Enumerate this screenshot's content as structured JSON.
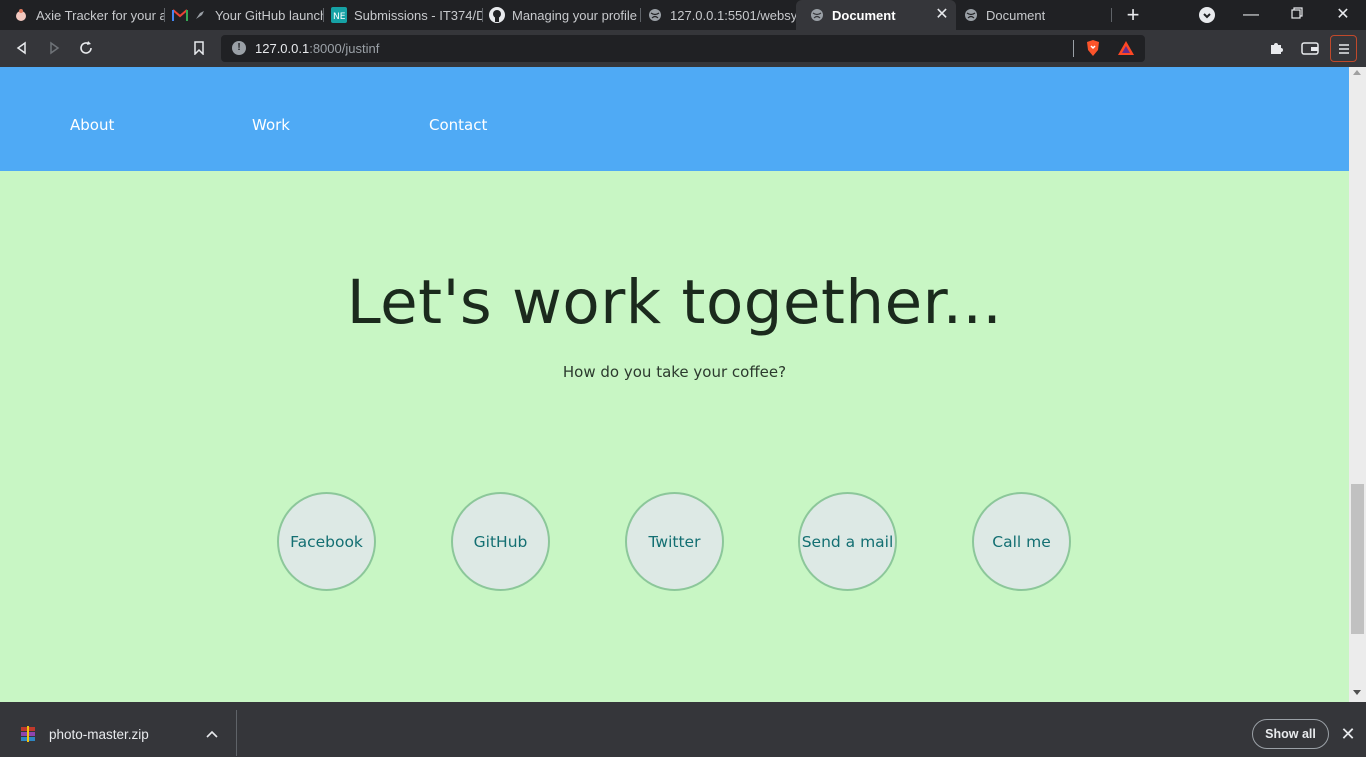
{
  "browser": {
    "tabs": [
      {
        "title": "Axie Tracker for your ac",
        "icon": "axie-favicon"
      },
      {
        "title": "Your GitHub launch",
        "icon": "gmail-favicon"
      },
      {
        "title": "Submissions - IT374/D",
        "icon": "neo-favicon"
      },
      {
        "title": "Managing your profile",
        "icon": "github-favicon"
      },
      {
        "title": "127.0.0.1:5501/websys/",
        "icon": "globe-favicon"
      },
      {
        "title": "Document",
        "icon": "globe-favicon",
        "active": true
      },
      {
        "title": "Document",
        "icon": "globe-favicon"
      }
    ],
    "address": {
      "host": "127.0.0.1",
      "rest": ":8000/justinf"
    }
  },
  "page": {
    "nav": [
      "About",
      "Work",
      "Contact"
    ],
    "headline": "Let's work together...",
    "subtitle": "How do you take your coffee?",
    "contacts": [
      "Facebook",
      "GitHub",
      "Twitter",
      "Send a mail",
      "Call me"
    ]
  },
  "downloads": {
    "file": "photo-master.zip",
    "show_all": "Show all"
  },
  "colors": {
    "navbar": "#4faaf5",
    "page_bg": "#c8f6c4",
    "circle_bg": "#dde9e5",
    "circle_text": "#136f72"
  }
}
